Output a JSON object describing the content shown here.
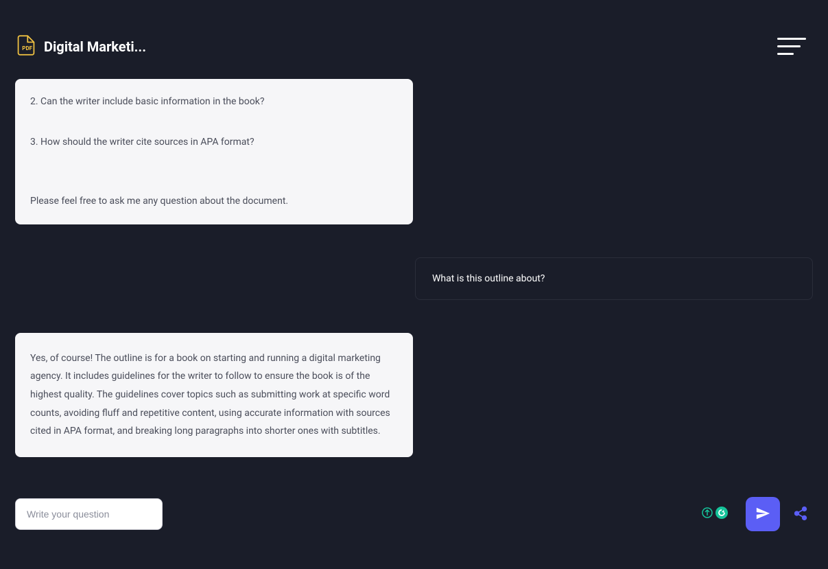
{
  "header": {
    "title": "Digital Marketi..."
  },
  "messages": {
    "assistant1": {
      "q2": "2. Can the writer include basic information in the book?",
      "q3": "3. How should the writer cite sources in APA format?",
      "closing": "Please feel free to ask me any question about the document."
    },
    "user1": {
      "text": "What is this outline about?"
    },
    "assistant2": {
      "text": "Yes, of course! The outline is for a book on starting and running a digital marketing agency. It includes guidelines for the writer to follow to ensure the book is of the highest quality. The guidelines cover topics such as submitting work at specific word counts, avoiding fluff and repetitive content, using accurate information with sources cited in APA format, and breaking long paragraphs into shorter ones with subtitles."
    }
  },
  "input": {
    "placeholder": "Write your question"
  }
}
